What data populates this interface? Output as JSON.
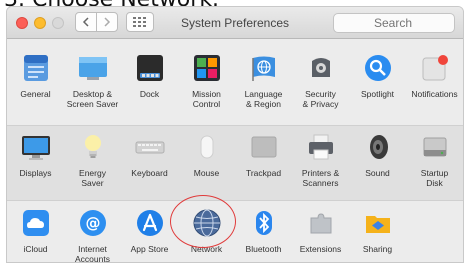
{
  "caption": "3. Choose Network.",
  "window": {
    "title": "System Preferences",
    "search_placeholder": "Search"
  },
  "row1": [
    {
      "label": "General",
      "icon": "general-icon"
    },
    {
      "label": "Desktop &\nScreen Saver",
      "icon": "desktop-icon"
    },
    {
      "label": "Dock",
      "icon": "dock-icon"
    },
    {
      "label": "Mission\nControl",
      "icon": "mission-control-icon"
    },
    {
      "label": "Language\n& Region",
      "icon": "language-icon"
    },
    {
      "label": "Security\n& Privacy",
      "icon": "security-icon"
    },
    {
      "label": "Spotlight",
      "icon": "spotlight-icon"
    },
    {
      "label": "Notifications",
      "icon": "notifications-icon"
    }
  ],
  "row2": [
    {
      "label": "Displays",
      "icon": "displays-icon"
    },
    {
      "label": "Energy\nSaver",
      "icon": "energy-icon"
    },
    {
      "label": "Keyboard",
      "icon": "keyboard-icon"
    },
    {
      "label": "Mouse",
      "icon": "mouse-icon"
    },
    {
      "label": "Trackpad",
      "icon": "trackpad-icon"
    },
    {
      "label": "Printers &\nScanners",
      "icon": "printer-icon"
    },
    {
      "label": "Sound",
      "icon": "sound-icon"
    },
    {
      "label": "Startup\nDisk",
      "icon": "startup-disk-icon"
    }
  ],
  "row3": [
    {
      "label": "iCloud",
      "icon": "icloud-icon"
    },
    {
      "label": "Internet\nAccounts",
      "icon": "internet-accounts-icon"
    },
    {
      "label": "App Store",
      "icon": "app-store-icon"
    },
    {
      "label": "Network",
      "icon": "network-icon"
    },
    {
      "label": "Bluetooth",
      "icon": "bluetooth-icon"
    },
    {
      "label": "Extensions",
      "icon": "extensions-icon"
    },
    {
      "label": "Sharing",
      "icon": "sharing-icon"
    }
  ],
  "colors": {
    "accent": "#1a8cff",
    "highlight_circle": "#e03b3b"
  }
}
